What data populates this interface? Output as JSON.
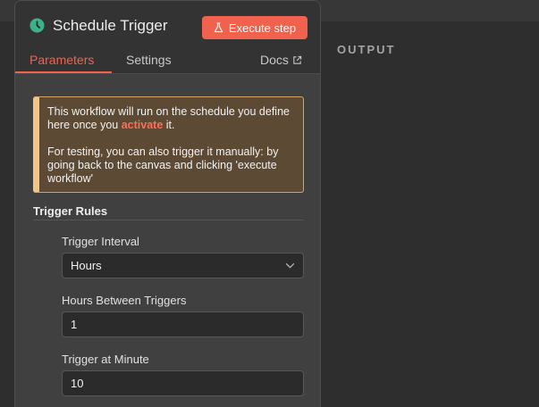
{
  "panel": {
    "title": "Schedule Trigger",
    "icon": "clock-icon",
    "icon_color": "#3bb18c",
    "execute_label": "Execute step",
    "accent_color": "#f0624e"
  },
  "tabs": [
    {
      "label": "Parameters",
      "active": true
    },
    {
      "label": "Settings",
      "active": false
    }
  ],
  "docs_label": "Docs",
  "notice": {
    "line1_pre": "This workflow will run on the schedule you define here once you",
    "line1_link": "activate",
    "line1_post": "it.",
    "line2": "For testing, you can also trigger it manually: by going back to the canvas and clicking 'execute workflow'"
  },
  "section": {
    "title": "Trigger Rules"
  },
  "fields": {
    "interval": {
      "label": "Trigger Interval",
      "value": "Hours"
    },
    "hours_between": {
      "label": "Hours Between Triggers",
      "value": "1"
    },
    "minute": {
      "label": "Trigger at Minute",
      "value": "10"
    }
  },
  "output": {
    "title": "OUTPUT"
  }
}
